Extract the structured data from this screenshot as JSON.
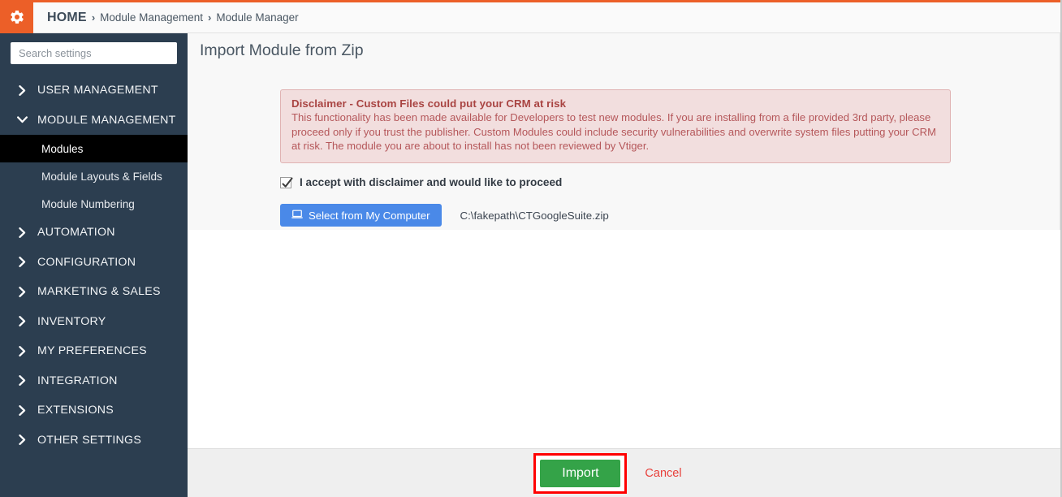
{
  "header": {
    "gear_icon": "gear-icon",
    "breadcrumb": {
      "home": "HOME",
      "separator": "›",
      "items": [
        "Module Management",
        "Module Manager"
      ]
    }
  },
  "sidebar": {
    "search": {
      "placeholder": "Search settings",
      "value": ""
    },
    "groups": [
      {
        "label": "USER MANAGEMENT",
        "icon": "chevron-right-icon",
        "expanded": false
      },
      {
        "label": "MODULE MANAGEMENT",
        "icon": "chevron-down-icon",
        "expanded": true,
        "children": [
          {
            "label": "Modules",
            "active": true
          },
          {
            "label": "Module Layouts & Fields",
            "active": false
          },
          {
            "label": "Module Numbering",
            "active": false
          }
        ]
      },
      {
        "label": "AUTOMATION",
        "icon": "chevron-right-icon",
        "expanded": false
      },
      {
        "label": "CONFIGURATION",
        "icon": "chevron-right-icon",
        "expanded": false
      },
      {
        "label": "MARKETING & SALES",
        "icon": "chevron-right-icon",
        "expanded": false
      },
      {
        "label": "INVENTORY",
        "icon": "chevron-right-icon",
        "expanded": false
      },
      {
        "label": "MY PREFERENCES",
        "icon": "chevron-right-icon",
        "expanded": false
      },
      {
        "label": "INTEGRATION",
        "icon": "chevron-right-icon",
        "expanded": false
      },
      {
        "label": "EXTENSIONS",
        "icon": "chevron-right-icon",
        "expanded": false
      },
      {
        "label": "OTHER SETTINGS",
        "icon": "chevron-right-icon",
        "expanded": false
      }
    ]
  },
  "main": {
    "title": "Import Module from Zip",
    "alert": {
      "title": "Disclaimer - Custom Files could put your CRM at risk",
      "body": "This functionality has been made available for Developers to test new modules. If you are installing from a file provided 3rd party, please proceed only if you trust the publisher. Custom Modules could include security vulnerabilities and overwrite system files putting your CRM at risk. The module you are about to install has not been reviewed by Vtiger."
    },
    "accept": {
      "label": "I accept with disclaimer and would like to proceed",
      "checked": true,
      "check_icon": "checkmark-icon"
    },
    "file": {
      "button_label": "Select from My Computer",
      "button_icon": "laptop-icon",
      "selected_path": "C:\\fakepath\\CTGoogleSuite.zip"
    }
  },
  "footer": {
    "import_label": "Import",
    "cancel_label": "Cancel"
  },
  "colors": {
    "accent_orange": "#ec5f28",
    "sidebar": "#2c3e50",
    "alert_bg": "#f2dede",
    "alert_text": "#a94442",
    "primary_blue": "#4a89e8",
    "success_green": "#34a348",
    "danger_red": "#e8413c",
    "highlight_red": "#ff0000"
  }
}
